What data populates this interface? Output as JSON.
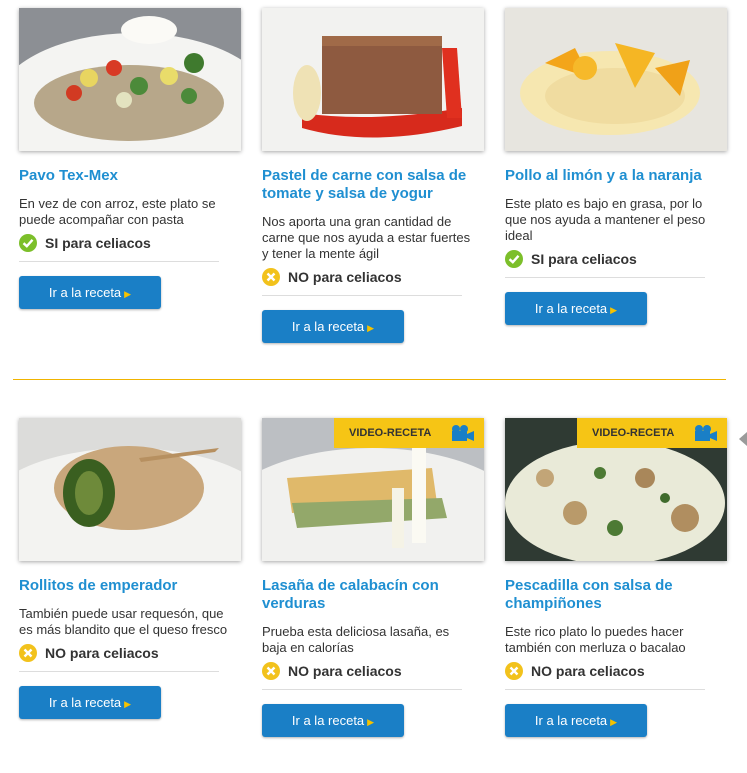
{
  "recipes": [
    {
      "title": "Pavo Tex-Mex",
      "desc": "En vez de con arroz, este plato se puede acompañar con pasta",
      "celiac": "SI para celiacos",
      "celiac_ok": true,
      "button": "Ir a la receta",
      "video": ""
    },
    {
      "title": "Pastel de carne con salsa de tomate y salsa de yogur",
      "desc": "Nos aporta una gran cantidad de carne que nos ayuda a estar fuertes y tener la mente ágil",
      "celiac": "NO para celiacos",
      "celiac_ok": false,
      "button": "Ir a la receta",
      "video": ""
    },
    {
      "title": "Pollo al limón y a la naranja",
      "desc": "Este plato es bajo en grasa, por lo que nos ayuda a mantener el peso ideal",
      "celiac": "SI para celiacos",
      "celiac_ok": true,
      "button": "Ir a la receta",
      "video": ""
    },
    {
      "title": "Rollitos de emperador",
      "desc": "También puede usar requesón, que es más blandito que el queso fresco",
      "celiac": "NO para celiacos",
      "celiac_ok": false,
      "button": "Ir a la receta",
      "video": ""
    },
    {
      "title": "Lasaña de calabacín con verduras",
      "desc": "Prueba esta deliciosa lasaña, es baja en calorías",
      "celiac": "NO para celiacos",
      "celiac_ok": false,
      "button": "Ir a la receta",
      "video": "VIDEO-RECETA"
    },
    {
      "title": "Pescadilla con salsa de champiñones",
      "desc": "Este rico plato lo puedes hacer también con merluza o bacalao",
      "celiac": "NO para celiacos",
      "celiac_ok": false,
      "button": "Ir a la receta",
      "video": "VIDEO-RECETA"
    }
  ],
  "colors": {
    "accent": "#1f8fd1",
    "button": "#1a7fc6",
    "ok": "#7cbf2a",
    "no": "#f2c21c",
    "divider": "#f0b400",
    "badge": "#f6c515"
  }
}
